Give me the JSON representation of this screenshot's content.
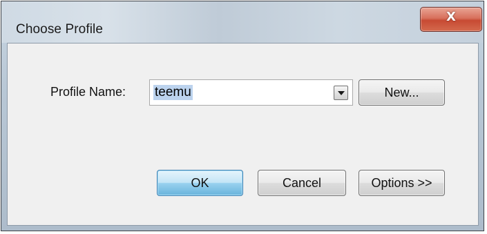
{
  "window": {
    "title": "Choose Profile",
    "close_glyph": "X"
  },
  "form": {
    "profile_label": "Profile Name:",
    "profile_value": "teemu",
    "dropdown_icon": "chevron-down-icon"
  },
  "buttons": {
    "new": "New...",
    "ok": "OK",
    "cancel": "Cancel",
    "options": "Options >>"
  },
  "colors": {
    "close_button": "#c74a33",
    "default_button": "#98d1ef",
    "selection_highlight": "#bcd3ee"
  }
}
